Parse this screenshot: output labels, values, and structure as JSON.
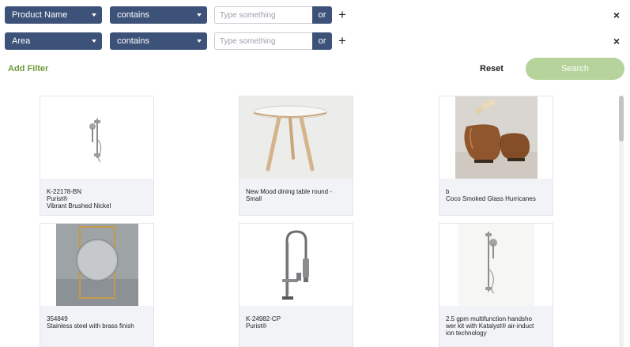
{
  "filters": [
    {
      "field": "Product Name",
      "operator": "contains",
      "value": "",
      "placeholder": "Type something",
      "or_label": "or",
      "add_icon": "plus-icon",
      "remove_icon": "close-icon"
    },
    {
      "field": "Area",
      "operator": "contains",
      "value": "",
      "placeholder": "Type something",
      "or_label": "or",
      "add_icon": "plus-icon",
      "remove_icon": "close-icon"
    }
  ],
  "symbols": {
    "plus": "+",
    "close": "×"
  },
  "actions": {
    "add_filter": "Add Filter",
    "reset": "Reset",
    "search": "Search"
  },
  "colors": {
    "select_bg": "#3d5278",
    "add_filter": "#6b9a3a",
    "search_btn": "#b5d39a"
  },
  "products": [
    {
      "lines": [
        "K-22178-BN",
        "Purist®",
        "Vibrant Brushed Nickel"
      ],
      "image": "handshower-icon"
    },
    {
      "lines": [
        "New Mood dining table round -",
        "Small"
      ],
      "image": "round-table-icon"
    },
    {
      "lines": [
        "b",
        "Coco Smoked Glass Hurricanes"
      ],
      "image": "glass-hurricanes-icon"
    },
    {
      "lines": [
        "354849",
        "Stainless steel with brass finish"
      ],
      "image": "round-mirror-icon"
    },
    {
      "lines": [
        "K-24982-CP",
        "Purist®"
      ],
      "image": "kitchen-faucet-icon"
    },
    {
      "lines": [
        "2.5 gpm multifunction handsho",
        "wer kit with Katalyst® air-induct",
        "ion technology"
      ],
      "image": "handshower-kit-icon"
    }
  ]
}
